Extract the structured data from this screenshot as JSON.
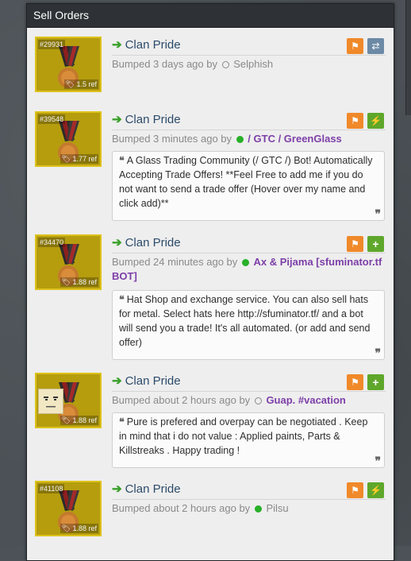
{
  "panel": {
    "title": "Sell Orders"
  },
  "listings": [
    {
      "id": "#29931",
      "price": "1.5 ref",
      "item_name": "Clan Pride",
      "bumped": "Bumped 3 days ago by",
      "user": "Selphish",
      "user_status": "offline",
      "buttons": [
        "flag-icon",
        "swap-icon"
      ],
      "description": ""
    },
    {
      "id": "#39548",
      "price": "1.77 ref",
      "item_name": "Clan Pride",
      "bumped": "Bumped 3 minutes ago by",
      "user": "/ GTC / GreenGlass",
      "user_status": "online",
      "buttons": [
        "flag-icon",
        "lightning-icon"
      ],
      "description": "A Glass Trading Community (/ GTC /) Bot! Automatically Accepting Trade Offers! **Feel Free to add me if you do not want to send a trade offer (Hover over my name and click add)**"
    },
    {
      "id": "#34470",
      "price": "1.88 ref",
      "item_name": "Clan Pride",
      "bumped": "Bumped 24 minutes ago by",
      "user": "Ax & Pijama [sfuminator.tf BOT]",
      "user_status": "online",
      "buttons": [
        "flag-icon",
        "plus-icon"
      ],
      "description": "Hat Shop and exchange service. You can also sell hats for metal. Select hats here http://sfuminator.tf/ and a bot will send you a trade! It's all automated. (or add and send offer)"
    },
    {
      "id": "",
      "price": "1.88 ref",
      "item_name": "Clan Pride",
      "bumped": "Bumped about 2 hours ago by",
      "user": "Guap. #vacation",
      "user_status": "offline",
      "buttons": [
        "flag-icon",
        "plus-icon"
      ],
      "description": "Pure is prefered and overpay can be negotiated . Keep in mind that i do not value : Applied paints, Parts & Killstreaks . Happy trading !"
    },
    {
      "id": "#41108",
      "price": "1.88 ref",
      "item_name": "Clan Pride",
      "bumped": "Bumped about 2 hours ago by",
      "user": "Pilsu",
      "user_status": "online",
      "buttons": [
        "flag-icon",
        "lightning-icon"
      ],
      "description": ""
    }
  ],
  "colors": {
    "accent_orange": "#f0892a",
    "accent_green": "#5fa72b",
    "accent_blue": "#6c8aa6",
    "quality_gold": "#b59d0e",
    "user_purple": "#7d3fa8"
  }
}
